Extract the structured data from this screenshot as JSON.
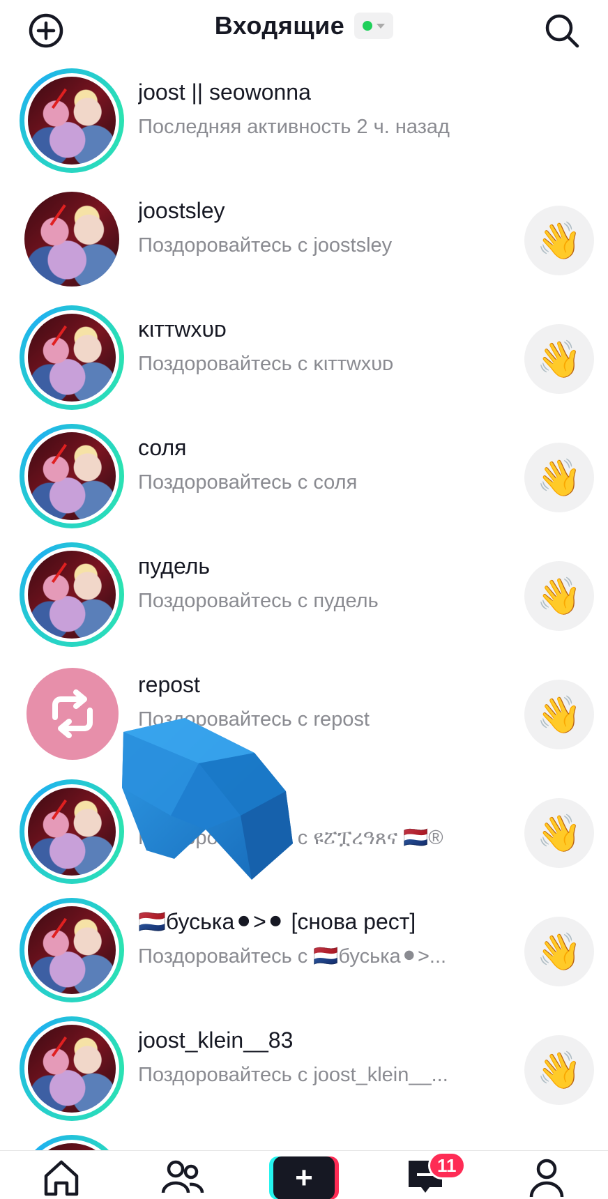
{
  "header": {
    "title": "Входящие",
    "status_color": "#1fd05a",
    "add_icon": "plus-circle-icon",
    "search_icon": "search-icon"
  },
  "inbox": {
    "items": [
      {
        "name": "joost || seowonna",
        "subtitle": "Последняя активность 2 ч. назад",
        "ring": true,
        "wave": false
      },
      {
        "name": "joostsley",
        "subtitle": "Поздоровайтесь с joostsley",
        "ring": false,
        "wave": true
      },
      {
        "name": "ĸιттwхυᴅ",
        "subtitle": "Поздоровайтесь с ĸιттwхυᴅ",
        "ring": true,
        "wave": true
      },
      {
        "name": "соля",
        "subtitle": "Поздоровайтесь с соля",
        "ring": true,
        "wave": true
      },
      {
        "name": "пудель",
        "subtitle": "Поздоровайтесь с пудель",
        "ring": true,
        "wave": true
      },
      {
        "name": "repost",
        "subtitle": "Поздоровайтесь с repost",
        "ring": false,
        "wave": true,
        "avatar": "repost-icon"
      },
      {
        "name": "ዩፘፗረዓጸና 🇳🇱®",
        "subtitle": "Поздоровайтесь с ዩፘፗረዓጸና 🇳🇱®",
        "ring": true,
        "wave": true
      },
      {
        "name": "🇳🇱буська⚫>⚫ [снова рест]",
        "subtitle": "Поздоровайтесь с 🇳🇱буська⚫>...",
        "ring": true,
        "wave": true
      },
      {
        "name": "joost_klein__83",
        "subtitle": "Поздоровайтесь с joost_klein__...",
        "ring": true,
        "wave": true
      }
    ],
    "wave_icon": "waving-hand-icon",
    "wave_glyph": "👋"
  },
  "bottom_nav": {
    "items": [
      "home-icon",
      "friends-icon",
      "create-icon",
      "inbox-icon",
      "profile-icon"
    ],
    "create_glyph": "+",
    "inbox_badge": "11",
    "accent_red": "#fe2c55",
    "accent_cyan": "#25f4ee"
  },
  "overlay": {
    "icon": "blue-arrow-pointer-icon",
    "color": "#1e88d6"
  }
}
